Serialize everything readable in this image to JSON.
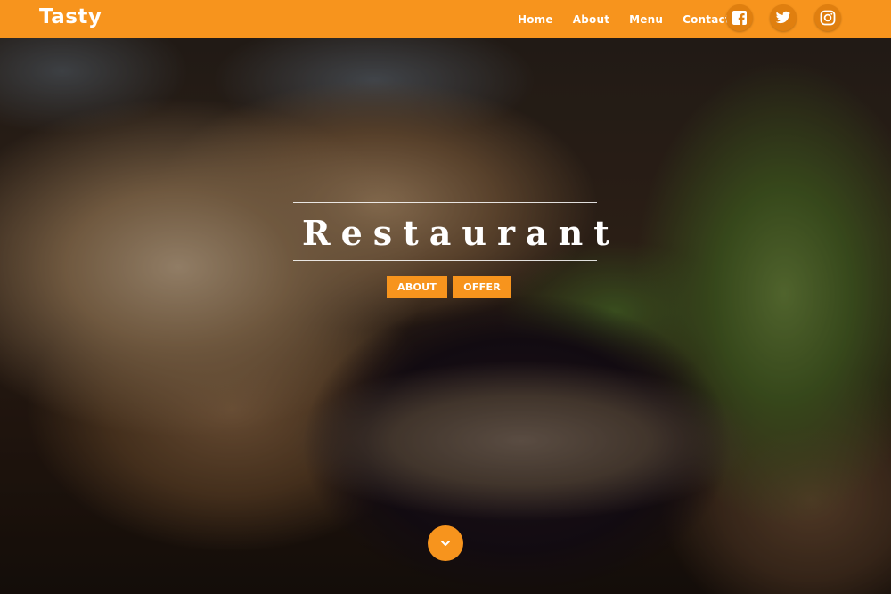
{
  "brand": {
    "name": "Tasty"
  },
  "nav": {
    "items": [
      {
        "label": "Home"
      },
      {
        "label": "About"
      },
      {
        "label": "Menu"
      },
      {
        "label": "Contact"
      }
    ]
  },
  "social": [
    {
      "icon": "facebook-icon"
    },
    {
      "icon": "twitter-icon"
    },
    {
      "icon": "instagram-icon"
    }
  ],
  "hero": {
    "title": "Restaurant",
    "buttons": [
      {
        "label": "ABOUT"
      },
      {
        "label": "OFFER"
      }
    ],
    "scroll_icon": "chevron-down-icon"
  },
  "colors": {
    "accent": "#f7941d",
    "social_bg": "#e07f0f",
    "text": "#ffffff"
  }
}
